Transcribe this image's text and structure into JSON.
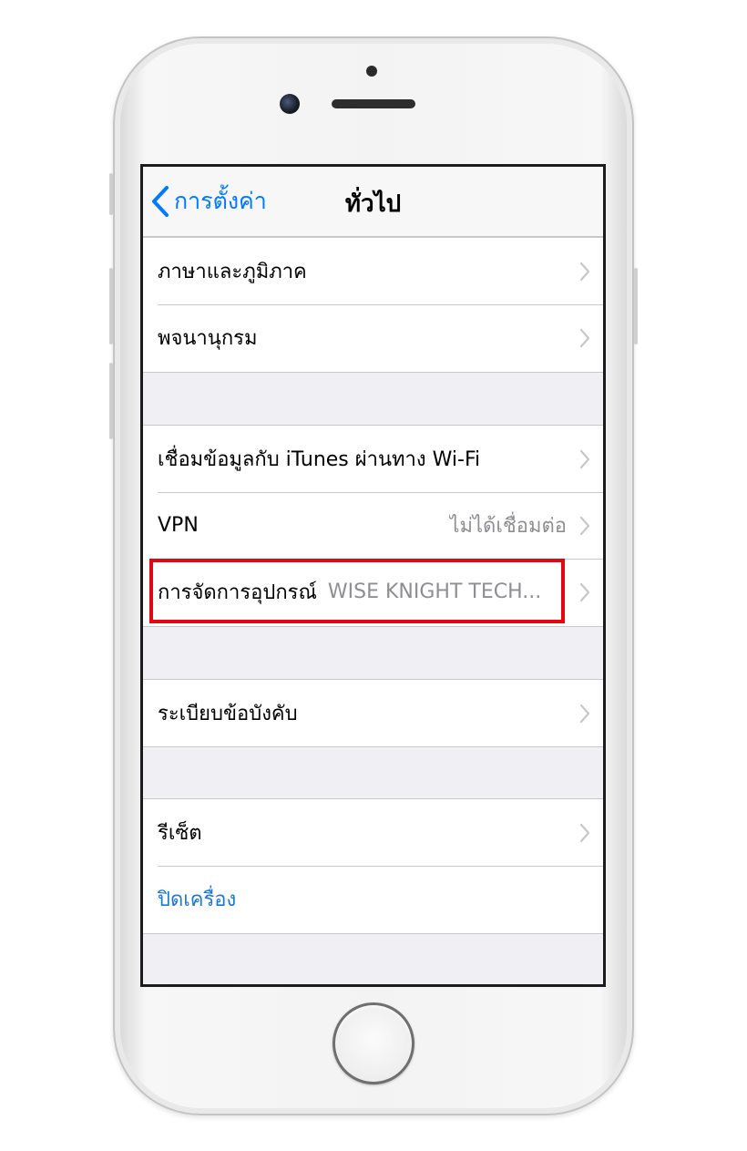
{
  "navbar": {
    "back_label": "การตั้งค่า",
    "title": "ทั่วไป"
  },
  "groups": [
    {
      "rows": [
        {
          "label": "ภาษาและภูมิภาค",
          "value": "",
          "chevron": true
        },
        {
          "label": "พจนานุกรม",
          "value": "",
          "chevron": true
        }
      ]
    },
    {
      "rows": [
        {
          "label": "เชื่อมข้อมูลกับ iTunes ผ่านทาง Wi-Fi",
          "value": "",
          "chevron": true
        },
        {
          "label": "VPN",
          "value": "ไม่ได้เชื่อมต่อ",
          "chevron": true
        },
        {
          "label": "การจัดการอุปกรณ์",
          "value": "WISE KNIGHT TECH...",
          "chevron": true,
          "highlighted": true
        }
      ]
    },
    {
      "rows": [
        {
          "label": "ระเบียบข้อบังคับ",
          "value": "",
          "chevron": true
        }
      ]
    },
    {
      "rows": [
        {
          "label": "รีเซ็ต",
          "value": "",
          "chevron": true
        },
        {
          "label": "ปิดเครื่อง",
          "value": "",
          "chevron": false,
          "color": "blue"
        }
      ]
    }
  ],
  "colors": {
    "accent": "#007aff",
    "highlight": "#e30613",
    "grouped_background": "#efeff4",
    "secondary_text": "#8e8e93"
  },
  "icons": {
    "back": "chevron-left-icon",
    "disclosure": "chevron-right-icon"
  }
}
